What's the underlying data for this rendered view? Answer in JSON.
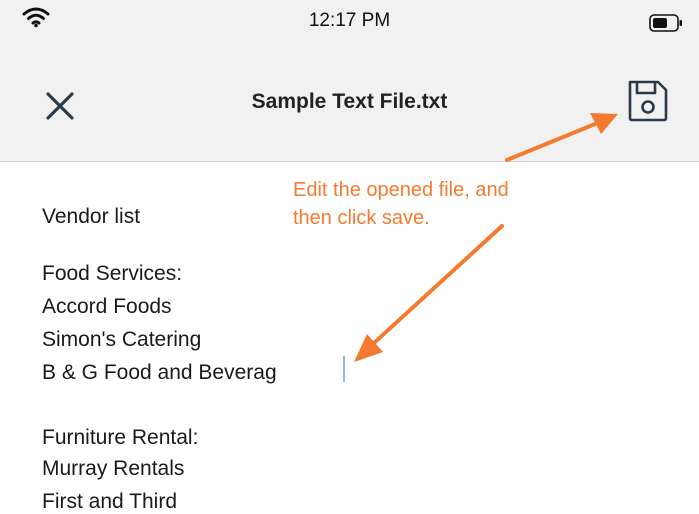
{
  "status_bar": {
    "time": "12:17 PM"
  },
  "nav": {
    "title": "Sample Text File.txt",
    "close_icon": "close-icon",
    "save_icon": "floppy-disk-icon"
  },
  "editor": {
    "lines": [
      "Vendor list",
      "Food Services:",
      "Accord Foods",
      "Simon's Catering",
      "B & G Food and Beverag",
      "Furniture Rental:",
      "Murray Rentals",
      "First and Third"
    ]
  },
  "annotation": {
    "line1": "Edit the opened file, and",
    "line2": "then click save.",
    "color": "#f47a30"
  },
  "colors": {
    "bar_background": "#f1f1f1",
    "icon_stroke": "#2b3a4a",
    "caret": "#8eb7e6"
  }
}
